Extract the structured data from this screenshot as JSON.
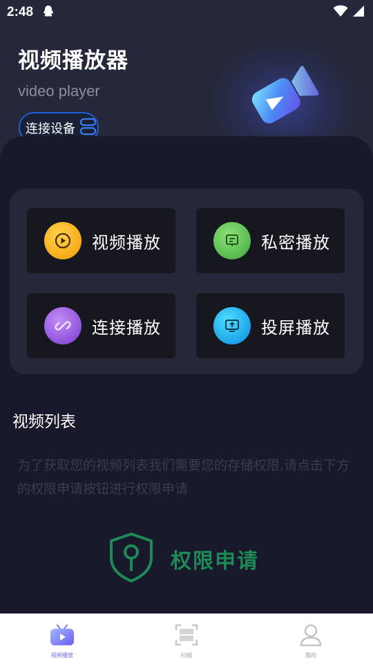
{
  "status_bar": {
    "time": "2:48"
  },
  "header": {
    "title": "视频播放器",
    "subtitle": "video player",
    "device_button": "连接设备"
  },
  "tiles": [
    {
      "label": "视频播放",
      "icon": "play-circle-icon",
      "color": "#f7a20c"
    },
    {
      "label": "私密播放",
      "icon": "message-icon",
      "color": "#48b94a"
    },
    {
      "label": "连接播放",
      "icon": "link-icon",
      "color": "#8b4bd8"
    },
    {
      "label": "投屏播放",
      "icon": "cast-screen-icon",
      "color": "#0a8ee0"
    }
  ],
  "video_list": {
    "title": "视频列表",
    "hint": "为了获取您的视频列表我们需要您的存储权限,请点击下方的权限申请按钮进行权限申请"
  },
  "permission_button": {
    "label": "权限申请",
    "color": "#1f8a57"
  },
  "bottom_nav": [
    {
      "label": "视频播放",
      "icon": "tv-icon",
      "active": true
    },
    {
      "label": "扫描",
      "icon": "scan-icon",
      "active": false
    },
    {
      "label": "我的",
      "icon": "user-icon",
      "active": false
    }
  ]
}
